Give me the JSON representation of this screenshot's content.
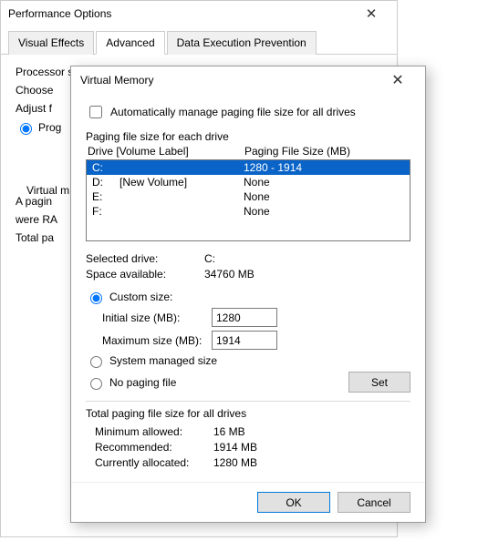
{
  "perf": {
    "title": "Performance Options",
    "tabs": {
      "visual": "Visual Effects",
      "advanced": "Advanced",
      "dep": "Data Execution Prevention"
    },
    "processor_label": "Processor scheduling",
    "choose": "Choose",
    "adjust": "Adjust f",
    "programs": "Prog",
    "virtual_m": "Virtual m",
    "paging_text": "A pagin",
    "were_ram": "were RA",
    "total_pa": "Total pa"
  },
  "vm": {
    "title": "Virtual Memory",
    "auto_manage": "Automatically manage paging file size for all drives",
    "each_drive_label": "Paging file size for each drive",
    "col_drive": "Drive  [Volume Label]",
    "col_size": "Paging File Size (MB)",
    "drives": [
      {
        "letter": "C:",
        "label": "",
        "size": "1280 - 1914",
        "selected": true
      },
      {
        "letter": "D:",
        "label": "[New Volume]",
        "size": "None",
        "selected": false
      },
      {
        "letter": "E:",
        "label": "",
        "size": "None",
        "selected": false
      },
      {
        "letter": "F:",
        "label": "",
        "size": "None",
        "selected": false
      }
    ],
    "selected_drive_label": "Selected drive:",
    "selected_drive_value": "C:",
    "space_label": "Space available:",
    "space_value": "34760 MB",
    "custom_size": "Custom size:",
    "initial_label": "Initial size (MB):",
    "initial_value": "1280",
    "max_label": "Maximum size (MB):",
    "max_value": "1914",
    "system_managed": "System managed size",
    "no_paging": "No paging file",
    "set_btn": "Set",
    "totals_label": "Total paging file size for all drives",
    "min_allowed_label": "Minimum allowed:",
    "min_allowed_value": "16 MB",
    "recommended_label": "Recommended:",
    "recommended_value": "1914 MB",
    "current_label": "Currently allocated:",
    "current_value": "1280 MB",
    "ok": "OK",
    "cancel": "Cancel"
  }
}
